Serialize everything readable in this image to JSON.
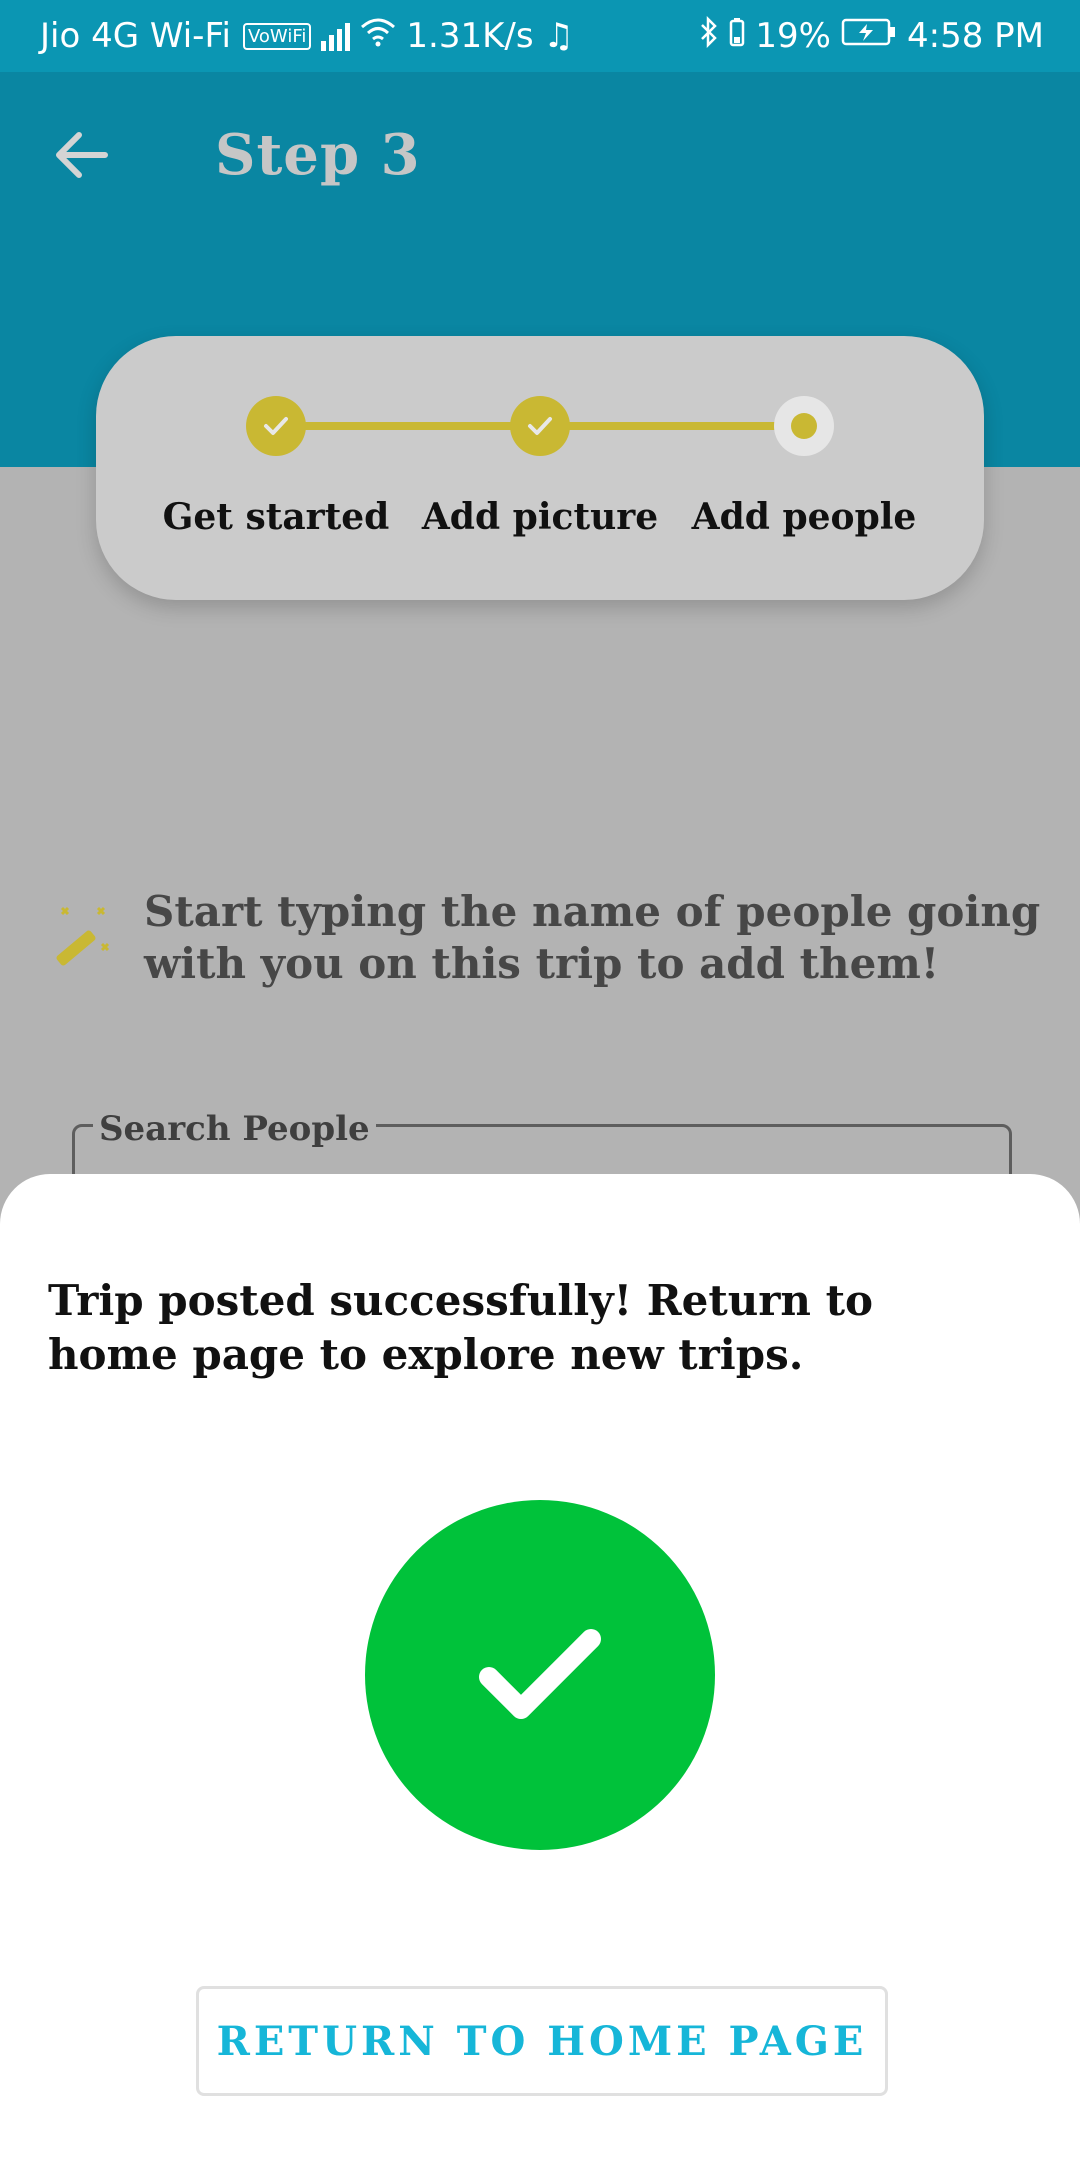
{
  "status_bar": {
    "carrier": "Jio 4G Wi-Fi",
    "vowifi": "VoWiFi",
    "speed": "1.31K/s",
    "battery": "19%",
    "time": "4:58 PM"
  },
  "app_bar": {
    "title": "Step 3"
  },
  "stepper": {
    "steps": [
      {
        "label": "Get started",
        "state": "done"
      },
      {
        "label": "Add picture",
        "state": "done"
      },
      {
        "label": "Add people",
        "state": "current"
      }
    ]
  },
  "hint": {
    "text": "Start typing the name of people going with you on this trip to add them!"
  },
  "search": {
    "label": "Search People"
  },
  "sheet": {
    "message": "Trip posted successfully! Return to home page to explore new trips.",
    "button_label": "RETURN TO HOME PAGE"
  },
  "colors": {
    "appbar": "#0a86a2",
    "accent": "#c9b833",
    "success": "#00c23a",
    "button_text": "#16b6d8"
  }
}
